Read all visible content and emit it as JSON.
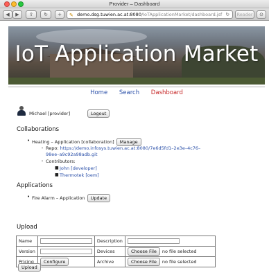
{
  "window": {
    "title": "Provider – Dashboard"
  },
  "toolbar": {
    "url_host": "demo.dsg.tuwien.ac.at:8080",
    "url_path": "/IoTApplicationMarket/dashboard.jsf",
    "reader_label": "Reader"
  },
  "banner": {
    "title": "IoT Application Market"
  },
  "nav": {
    "home": "Home",
    "search": "Search",
    "dashboard": "Dashboard"
  },
  "user": {
    "name": "Michael [provider]",
    "logout_label": "Logout"
  },
  "collaborations": {
    "heading": "Collaborations",
    "item": {
      "title": "Heating – Application [collaboration]",
      "manage_label": "Manage",
      "repo_label": "Repo:",
      "repo_url_line1": "https://demo.infosys.tuwien.ac.at:8080/7e6d5fd1–2e3e–4c76–",
      "repo_url_line2": "98ee–a9c92a98adb.git",
      "contributors_label": "Contributors:",
      "contributors": [
        "John [developer]",
        "Thermotek [oem]"
      ]
    }
  },
  "applications": {
    "heading": "Applications",
    "item": {
      "title": "Fire Alarm – Application",
      "update_label": "Update"
    }
  },
  "upload": {
    "heading": "Upload",
    "name_label": "Name",
    "description_label": "Description",
    "version_label": "Version",
    "devices_label": "Devices",
    "pricing_label": "Pricing",
    "archive_label": "Archive",
    "choose_file_label": "Choose File",
    "no_file_text": "no file selected",
    "configure_label": "Configure",
    "upload_label": "Upload"
  }
}
